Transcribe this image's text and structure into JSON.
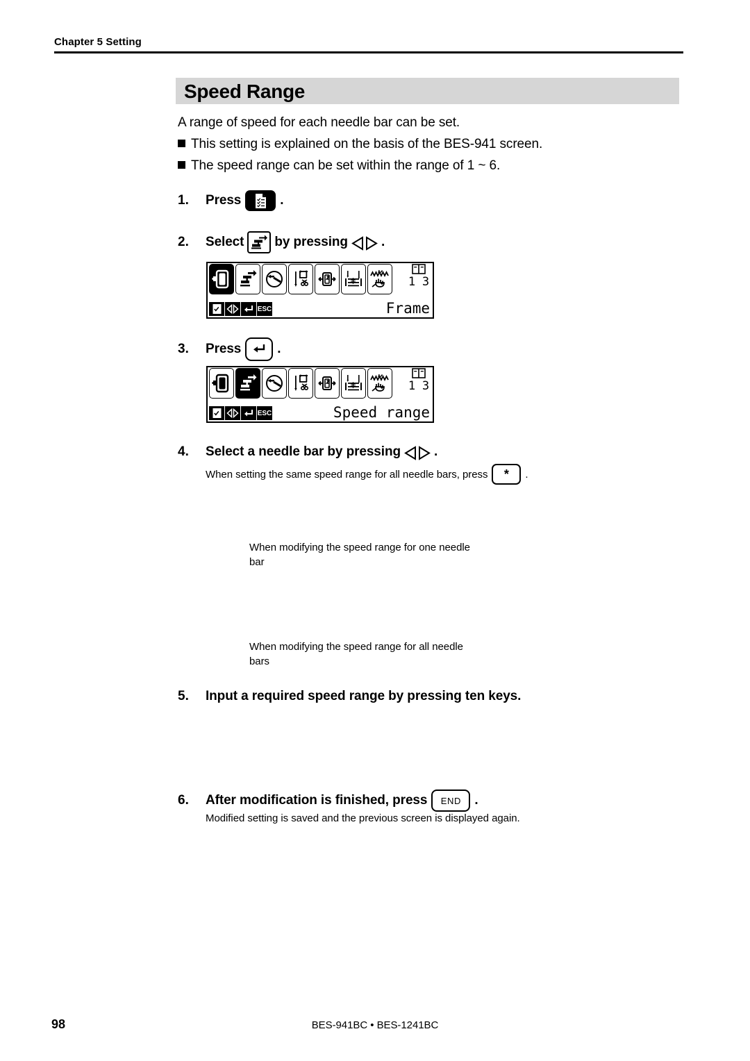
{
  "header": {
    "chapter": "Chapter 5 Setting"
  },
  "title": {
    "text": "Speed Range"
  },
  "intro": {
    "lead": "A range of speed for each needle bar can be set.",
    "bullets": [
      "This setting is explained on the basis of the BES-941 screen.",
      "The speed range can be set within the range of 1 ~ 6."
    ]
  },
  "steps": [
    {
      "number": "1.",
      "text_before": "Press",
      "key": "setting-menu-key",
      "text_after": "."
    },
    {
      "number": "2.",
      "text_before": "Select",
      "key": "speed-range-icon-key",
      "text_mid": "by pressing",
      "arrows": "left-right-arrows",
      "text_after": "."
    },
    {
      "number": "3.",
      "text_before": "Press",
      "key": "enter-key",
      "key_label": "↵",
      "text_after": "."
    },
    {
      "number": "4.",
      "text_before": "Select a needle bar by pressing",
      "arrows": "left-right-arrows",
      "text_after": ".",
      "note_before": "When setting the same speed range for all needle bars, press",
      "note_key_label": "*",
      "note_after": "."
    },
    {
      "number": "5.",
      "text_before": "Input a required speed range by pressing ten keys."
    },
    {
      "number": "6.",
      "text_before": "After modification is finished, press",
      "key_label": "END",
      "text_after": ".",
      "note_before": "Modified setting is saved and the previous screen is displayed again."
    }
  ],
  "lcd_screens": [
    {
      "name": "frame-screen",
      "selected_index": 0,
      "icons": [
        "frame-icon",
        "speed-range-icon",
        "speed-gauge-icon",
        "thread-trim-icon",
        "frame-move-icon",
        "needle-height-icon",
        "thread-tension-icon"
      ],
      "page_current": "1",
      "page_total": "3",
      "label": "Frame",
      "softkeys": [
        "select-icon",
        "left-right-icon",
        "enter-icon",
        "ESC"
      ]
    },
    {
      "name": "speed-range-screen",
      "selected_index": 1,
      "icons": [
        "frame-icon",
        "speed-range-icon",
        "speed-gauge-icon",
        "thread-trim-icon",
        "frame-move-icon",
        "needle-height-icon",
        "thread-tension-icon"
      ],
      "page_current": "1",
      "page_total": "3",
      "label": "Speed range",
      "softkeys": [
        "select-icon",
        "left-right-icon",
        "enter-icon",
        "ESC"
      ]
    }
  ],
  "captions": [
    "When modifying the speed range for one needle bar",
    "When modifying the speed range for all needle bars"
  ],
  "footer": {
    "page_number": "98",
    "models": "BES-941BC • BES-1241BC"
  }
}
